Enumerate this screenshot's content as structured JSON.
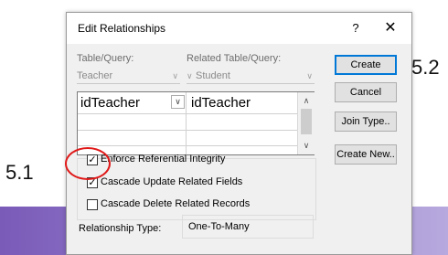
{
  "callouts": {
    "left": "5.1",
    "right": "5.2"
  },
  "dialog": {
    "title": "Edit Relationships",
    "help_label": "?",
    "close_label": "✕",
    "table_query_label": "Table/Query:",
    "related_table_label": "Related Table/Query:",
    "table_value": "Teacher",
    "related_value": "Student",
    "grid": {
      "rows": [
        {
          "left": "idTeacher",
          "right": "idTeacher"
        }
      ]
    },
    "buttons": {
      "create": "Create",
      "cancel": "Cancel",
      "join_type": "Join Type..",
      "create_new": "Create New.."
    },
    "checkboxes": {
      "enforce": {
        "label": "Enforce Referential Integrity",
        "checked": true,
        "mark": "✓"
      },
      "cascade_update": {
        "label": "Cascade Update Related Fields",
        "checked": true,
        "mark": "✓"
      },
      "cascade_delete": {
        "label": "Cascade Delete Related Records",
        "checked": false,
        "mark": ""
      }
    },
    "relationship_type_label": "Relationship Type:",
    "relationship_type_value": "One-To-Many"
  },
  "colors": {
    "highlight_circle": "#e01818",
    "default_button_border": "#0078d7",
    "background_band": "#7a5bb8"
  },
  "icons": {
    "dropdown": "chevron-down-icon",
    "scroll_up": "scroll-up-icon",
    "scroll_down": "scroll-down-icon"
  }
}
